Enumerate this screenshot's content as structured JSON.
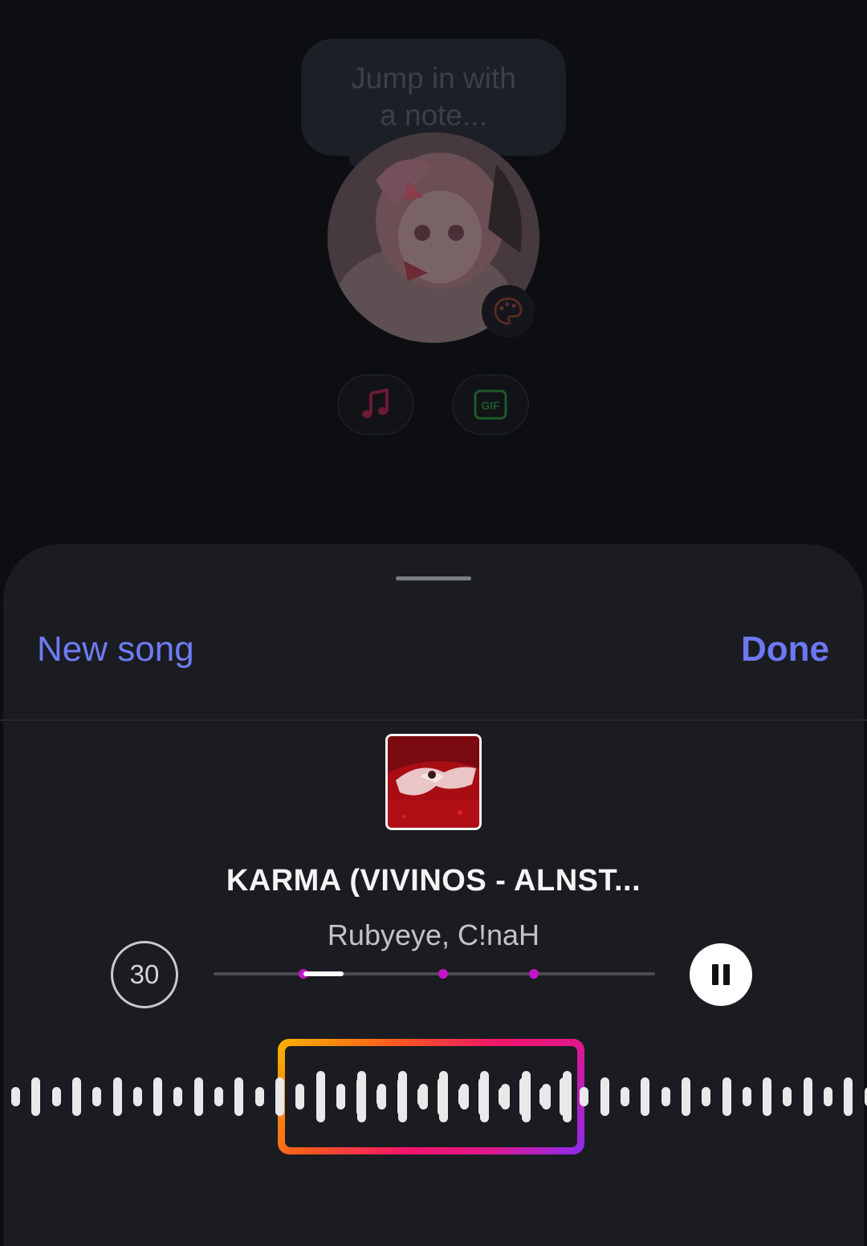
{
  "note": {
    "placeholder_line1": "Jump in with",
    "placeholder_line2": "a note..."
  },
  "composer": {
    "music_icon": "music-note-icon",
    "gif_icon": "gif-icon",
    "gif_label": "GIF",
    "palette_icon": "palette-icon"
  },
  "sheet": {
    "new_song_label": "New song",
    "done_label": "Done",
    "song_title": "KARMA (VIVINOS - ALNST...",
    "artist": "Rubyeye, C!naH",
    "duration": "30",
    "pause_icon": "pause-icon"
  },
  "colors": {
    "accent": "#6f7cf5",
    "marker": "#c514c9",
    "sheet_bg": "#1a1c21",
    "page_bg": "#0c0e12"
  }
}
